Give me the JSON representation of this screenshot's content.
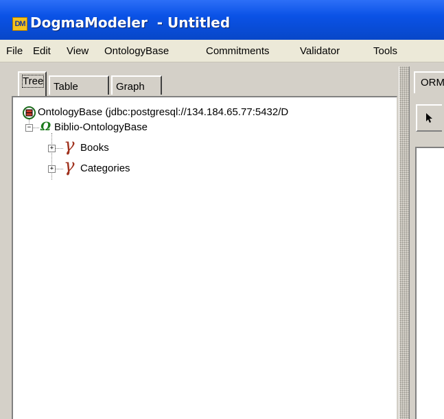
{
  "window": {
    "app_name": "DogmaModeler",
    "title": "DogmaModeler  - Untitled",
    "icon_text": "DM"
  },
  "menu": [
    "File",
    "Edit",
    "View",
    "OntologyBase",
    "Commitments",
    "Validator",
    "Tools"
  ],
  "tabs": [
    "Tree",
    "Table",
    "Graph"
  ],
  "active_tab": "Tree",
  "tree": {
    "root": {
      "label": "OntologyBase (jdbc:postgresql://134.184.65.77:5432/D",
      "icon": "database-icon"
    },
    "base": {
      "label": "Biblio-OntologyBase",
      "icon": "omega-icon",
      "expanded": true
    },
    "children": [
      {
        "label": "Books",
        "icon": "gamma-icon",
        "expanded": false
      },
      {
        "label": "Categories",
        "icon": "gamma-icon",
        "expanded": false
      }
    ]
  },
  "right_pane": {
    "tab_label": "ORM",
    "tool": "pointer-icon"
  },
  "colors": {
    "titlebar": "#0a52e6",
    "face": "#d4d0c8",
    "menubar": "#ece9d8",
    "omega": "#1a7a1a",
    "gamma": "#a0321e"
  }
}
